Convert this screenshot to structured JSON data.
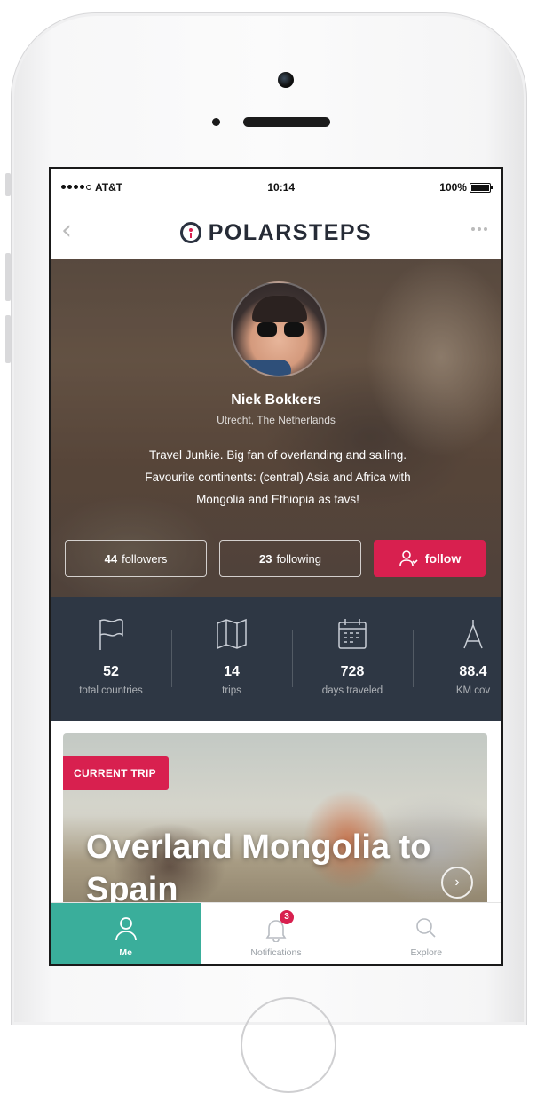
{
  "status_bar": {
    "carrier": "AT&T",
    "time": "10:14",
    "battery": "100%"
  },
  "nav": {
    "back_icon": "chevron-left-icon",
    "brand": "POLARSTEPS",
    "more_icon": "more-dots-icon"
  },
  "profile": {
    "name": "Niek Bokkers",
    "location": "Utrecht, The Netherlands",
    "bio_lines": [
      "Travel Junkie. Big fan of overlanding and sailing.",
      "Favourite continents: (central) Asia and Africa with",
      "Mongolia and Ethiopia as favs!"
    ],
    "followers_count": "44",
    "followers_label": "followers",
    "following_count": "23",
    "following_label": "following",
    "follow_label": "follow"
  },
  "stats": [
    {
      "icon": "flag-icon",
      "value": "52",
      "label": "total countries"
    },
    {
      "icon": "map-icon",
      "value": "14",
      "label": "trips"
    },
    {
      "icon": "calendar-icon",
      "value": "728",
      "label": "days traveled"
    },
    {
      "icon": "compass-icon",
      "value": "88.4",
      "label": "KM cov"
    }
  ],
  "current_trip": {
    "badge": "CURRENT TRIP",
    "title": "Overland Mongolia to Spain"
  },
  "tabs": [
    {
      "icon": "user-icon",
      "label": "Me",
      "active": true
    },
    {
      "icon": "bell-icon",
      "label": "Notifications",
      "badge": "3"
    },
    {
      "icon": "search-icon",
      "label": "Explore"
    }
  ],
  "colors": {
    "accent": "#d8204f",
    "stats_bg": "#2e3744",
    "tab_active": "#3aae9b",
    "brand_text": "#262b36"
  }
}
